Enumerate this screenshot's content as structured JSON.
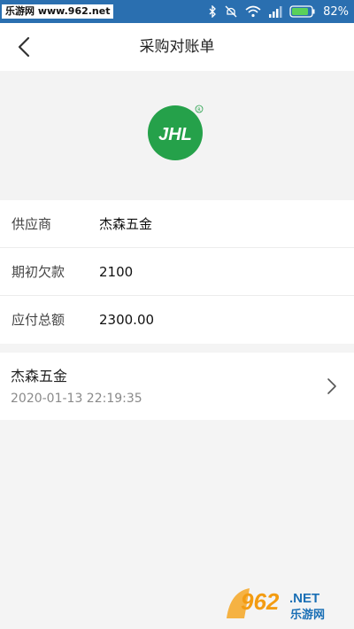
{
  "status_bar": {
    "site_label": "乐游网 www.962.net",
    "battery_percent": "82%",
    "icons": [
      "bluetooth-icon",
      "mute-icon",
      "wifi-icon",
      "signal-icon",
      "battery-icon"
    ]
  },
  "nav": {
    "title": "采购对账单",
    "back_icon": "chevron-left-icon"
  },
  "logo": {
    "text": "JHL",
    "registered": "®",
    "color": "#25a14a"
  },
  "info": {
    "rows": [
      {
        "label": "供应商",
        "value": "杰森五金"
      },
      {
        "label": "期初欠款",
        "value": "2100"
      },
      {
        "label": "应付总额",
        "value": "2300.00"
      }
    ]
  },
  "record": {
    "name": "杰森五金",
    "time": "2020-01-13 22:19:35"
  },
  "watermark": {
    "text": "962.NET",
    "sub": "乐游网"
  }
}
